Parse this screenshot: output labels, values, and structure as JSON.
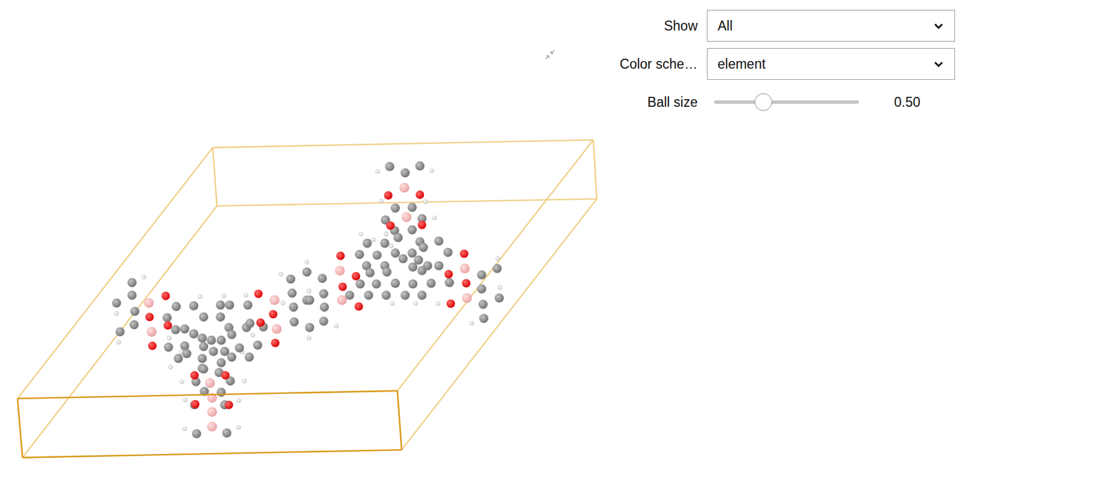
{
  "controls": [
    {
      "kind": "dropdown",
      "label": "Show",
      "value": "All"
    },
    {
      "kind": "dropdown",
      "label": "Color sche…",
      "value": "element"
    },
    {
      "kind": "slider",
      "label": "Ball size",
      "level": 0.34,
      "reading": "0.50"
    }
  ]
}
